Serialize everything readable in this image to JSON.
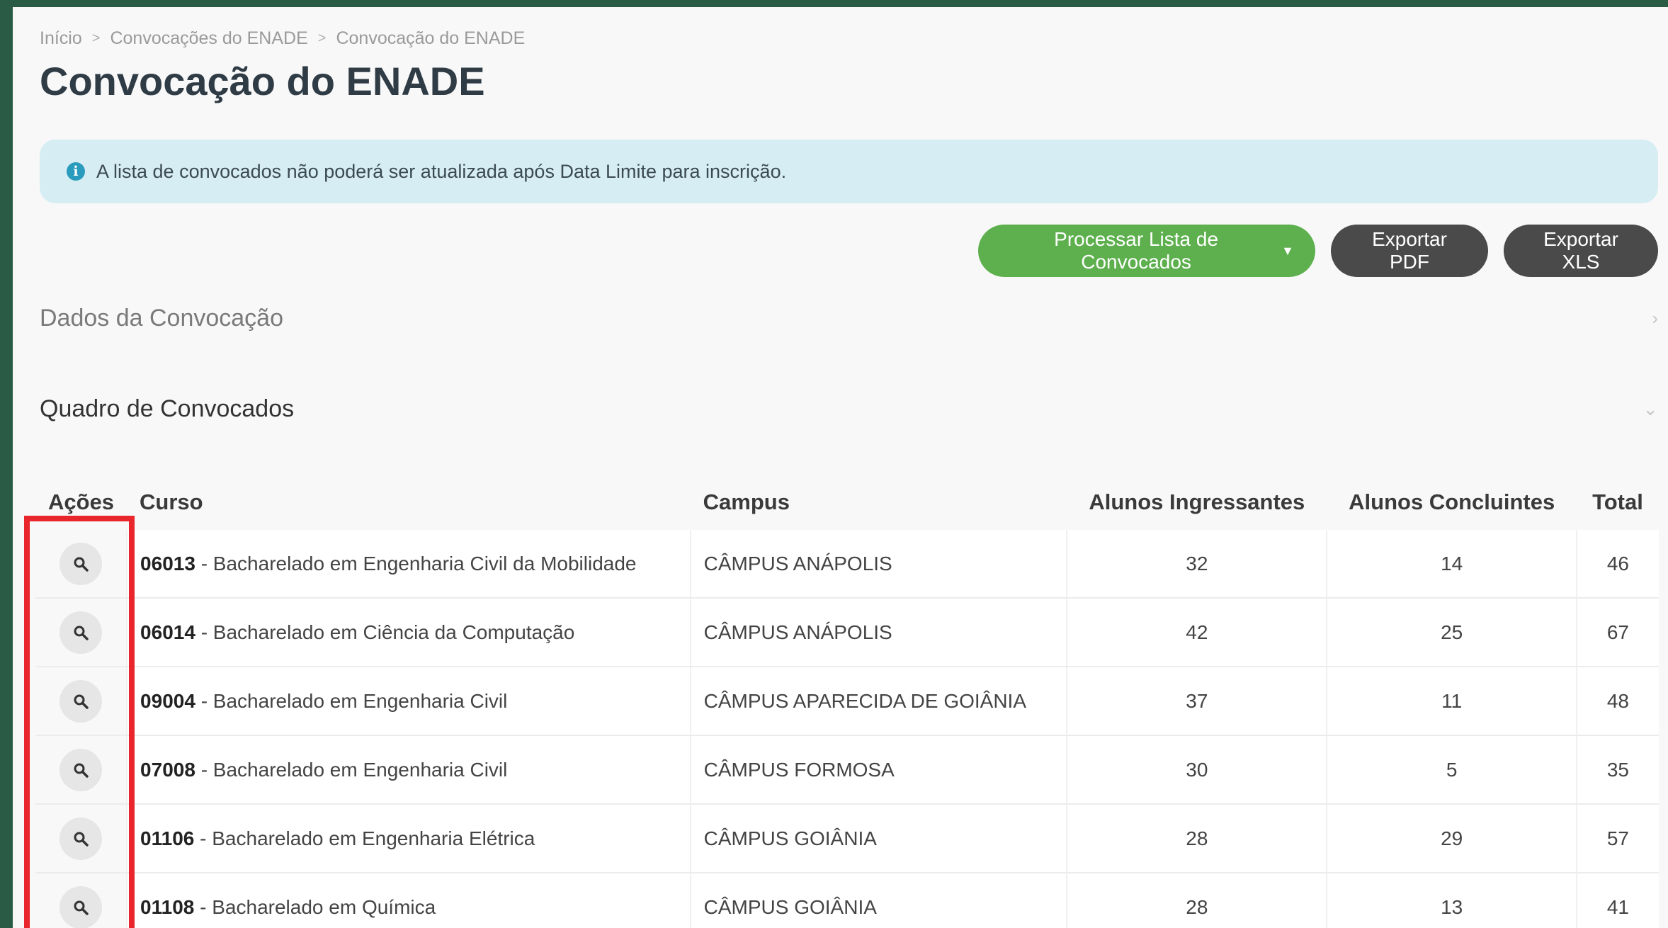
{
  "breadcrumb": [
    "Início",
    "Convocações do ENADE",
    "Convocação do ENADE"
  ],
  "page_title": "Convocação do ENADE",
  "alert": {
    "icon": "info-icon",
    "text": "A lista de convocados não poderá ser atualizada após Data Limite para inscrição."
  },
  "toolbar": {
    "process_label": "Processar Lista de Convocados",
    "pdf_label": "Exportar PDF",
    "xls_label": "Exportar XLS"
  },
  "sections": {
    "dados": "Dados da Convocação",
    "quadro": "Quadro de Convocados"
  },
  "table": {
    "headers": [
      "Ações",
      "Curso",
      "Campus",
      "Alunos Ingressantes",
      "Alunos Concluintes",
      "Total"
    ],
    "rows": [
      {
        "code": "06013",
        "course": " - Bacharelado em Engenharia Civil da Mobilidade",
        "campus": "CÂMPUS ANÁPOLIS",
        "ingressantes": "32",
        "concluintes": "14",
        "total": "46"
      },
      {
        "code": "06014",
        "course": " - Bacharelado em Ciência da Computação",
        "campus": "CÂMPUS ANÁPOLIS",
        "ingressantes": "42",
        "concluintes": "25",
        "total": "67"
      },
      {
        "code": "09004",
        "course": " - Bacharelado em Engenharia Civil",
        "campus": "CÂMPUS APARECIDA DE GOIÂNIA",
        "ingressantes": "37",
        "concluintes": "11",
        "total": "48"
      },
      {
        "code": "07008",
        "course": " - Bacharelado em Engenharia Civil",
        "campus": "CÂMPUS FORMOSA",
        "ingressantes": "30",
        "concluintes": "5",
        "total": "35"
      },
      {
        "code": "01106",
        "course": " - Bacharelado em Engenharia Elétrica",
        "campus": "CÂMPUS GOIÂNIA",
        "ingressantes": "28",
        "concluintes": "29",
        "total": "57"
      },
      {
        "code": "01108",
        "course": " - Bacharelado em Química",
        "campus": "CÂMPUS GOIÂNIA",
        "ingressantes": "28",
        "concluintes": "13",
        "total": "41"
      }
    ]
  },
  "colors": {
    "accent_green": "#5db04d",
    "dark_button": "#4a4a4a",
    "alert_bg": "#d6eef3",
    "highlight": "#e8262b"
  }
}
